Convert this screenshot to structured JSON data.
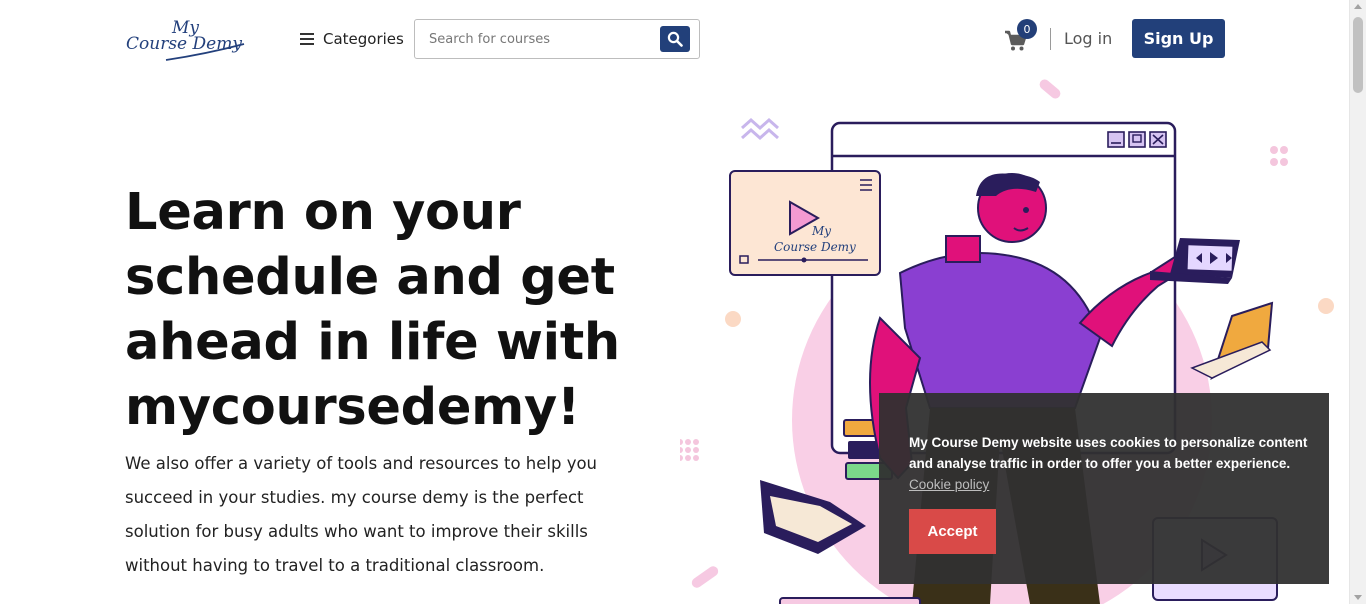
{
  "header": {
    "logo_line1": "My",
    "logo_line2": "Course Demy",
    "categories_label": "Categories",
    "search_placeholder": "Search for courses",
    "cart_count": "0",
    "login_label": "Log in",
    "signup_label": "Sign Up"
  },
  "hero": {
    "title": "Learn on your schedule and get ahead in life with mycoursedemy!",
    "description": "We also offer a variety of tools and resources to help you succeed in your studies. my course demy is the perfect solution for busy adults who want to improve their skills without having to travel to a traditional classroom."
  },
  "illustration": {
    "video_logo_line1": "My",
    "video_logo_line2": "Course Demy"
  },
  "cookie": {
    "message": "My Course Demy website uses cookies to personalize content and analyse traffic in order to offer you a better experience.",
    "policy_link": "Cookie policy",
    "accept_label": "Accept"
  },
  "colors": {
    "brand_navy": "#22407a",
    "accent_pink": "#e0117a",
    "accent_purple": "#8a3fd1",
    "cookie_accept": "#d94a48",
    "cookie_bg": "#303030"
  },
  "icons": [
    "hamburger-icon",
    "search-icon",
    "cart-icon",
    "play-icon",
    "minimize-icon",
    "maximize-icon",
    "close-icon"
  ]
}
